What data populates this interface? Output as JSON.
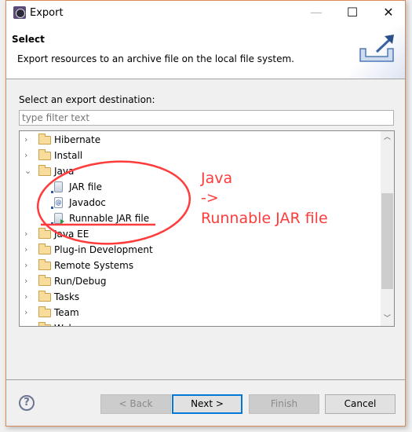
{
  "window": {
    "title": "Export",
    "minimize": "—",
    "maximize": "☐",
    "close": "✕"
  },
  "header": {
    "title": "Select",
    "description": "Export resources to an archive file on the local file system.",
    "icon": "export-icon"
  },
  "main": {
    "label": "Select an export destination:",
    "filter_placeholder": "type filter text",
    "tree": [
      {
        "label": "Hibernate",
        "type": "folder",
        "expanded": false
      },
      {
        "label": "Install",
        "type": "folder",
        "expanded": false
      },
      {
        "label": "Java",
        "type": "folder",
        "expanded": true
      },
      {
        "label": "JAR file",
        "type": "jar",
        "level": 1
      },
      {
        "label": "Javadoc",
        "type": "javadoc",
        "level": 1
      },
      {
        "label": "Runnable JAR file",
        "type": "runnable-jar",
        "level": 1
      },
      {
        "label": "Java EE",
        "type": "folder",
        "expanded": false
      },
      {
        "label": "Plug-in Development",
        "type": "folder",
        "expanded": false
      },
      {
        "label": "Remote Systems",
        "type": "folder",
        "expanded": false
      },
      {
        "label": "Run/Debug",
        "type": "folder",
        "expanded": false
      },
      {
        "label": "Tasks",
        "type": "folder",
        "expanded": false
      },
      {
        "label": "Team",
        "type": "folder",
        "expanded": false
      },
      {
        "label": "Web",
        "type": "folder",
        "expanded": false
      }
    ]
  },
  "annotation": {
    "line1": "Java",
    "line2": "->",
    "line3": "Runnable JAR file",
    "color": "#ff3b3b"
  },
  "footer": {
    "help": "?",
    "back": "< Back",
    "next": "Next >",
    "finish": "Finish",
    "cancel": "Cancel"
  },
  "colors": {
    "accent": "#0078d7",
    "window_border": "#d98a5a"
  }
}
